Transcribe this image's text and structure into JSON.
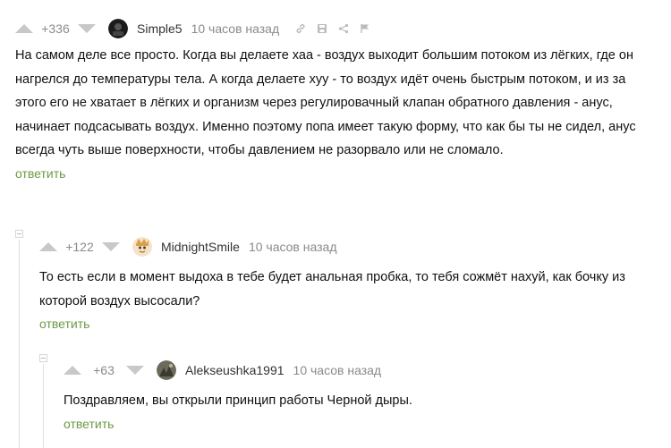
{
  "comments": [
    {
      "rating": "+336",
      "author": "Simple5",
      "time": "10 часов назад",
      "text": "На самом деле все просто. Когда вы делаете хаа - воздух выходит большим потоком из лёгких, где он нагрелся до температуры тела. А когда делаете хуу - то воздух идёт очень быстрым потоком, и из за этого его не хватает в лёгких и организм через регулировачный клапан обратного давления - анус, начинает подсасывать воздух. Именно поэтому попа имеет такую форму, что как бы ты не сидел, анус всегда чуть выше поверхности, чтобы давлением не разорвало или не сломало.",
      "reply": "ответить"
    },
    {
      "rating": "+122",
      "author": "MidnightSmile",
      "time": "10 часов назад",
      "text": "То есть если в момент выдоха в тебе будет анальная пробка, то тебя сожмёт нахуй, как бочку из которой воздух высосали?",
      "reply": "ответить"
    },
    {
      "rating": "+63",
      "author": "Alekseushka1991",
      "time": "10 часов назад",
      "text": "Поздравляем, вы открыли принцип работы Черной дыры.",
      "reply": "ответить"
    }
  ],
  "icons": {
    "upvote": "triangle-up",
    "downvote": "triangle-down",
    "link": "link-icon",
    "save": "save-icon",
    "share": "share-icon",
    "report": "flag-icon"
  },
  "colors": {
    "reply": "#6c9a45",
    "vote": "#c8c8c8",
    "meta": "#8a8a8a"
  }
}
